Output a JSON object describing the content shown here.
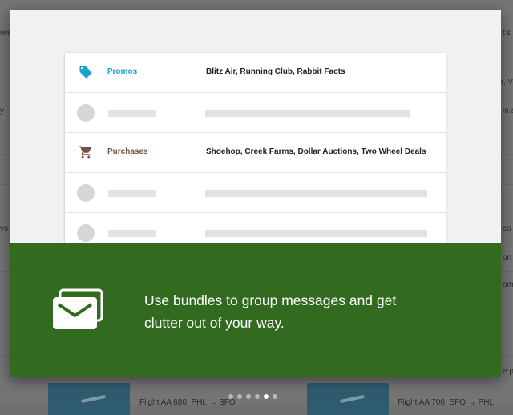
{
  "background": {
    "flights": [
      {
        "label": "Flight AA 680, PHL → SFO"
      },
      {
        "label": "Flight AA 700, SFO → PHL"
      }
    ],
    "edge_fragments": [
      "res",
      "t's",
      "y",
      "r, V",
      "in a",
      "ys",
      "co",
      "on",
      "om",
      "e p"
    ]
  },
  "preview": {
    "rows": [
      {
        "type": "bundle",
        "icon": "tag-icon",
        "label": "Promos",
        "label_color": "#1aa3c6",
        "description": "Blitz Air, Running Club, Rabbit Facts"
      },
      {
        "type": "placeholder"
      },
      {
        "type": "bundle",
        "icon": "cart-icon",
        "label": "Purchases",
        "label_color": "#7a5045",
        "description": "Shoehop, Creek Farms, Dollar Auctions, Two Wheel Deals"
      },
      {
        "type": "placeholder"
      },
      {
        "type": "placeholder"
      }
    ]
  },
  "banner": {
    "text": "Use bundles to group messages and get clutter out of your way.",
    "color": "#326a20",
    "icon": "bundles-icon"
  },
  "pager": {
    "count": 6,
    "active_index": 4
  }
}
